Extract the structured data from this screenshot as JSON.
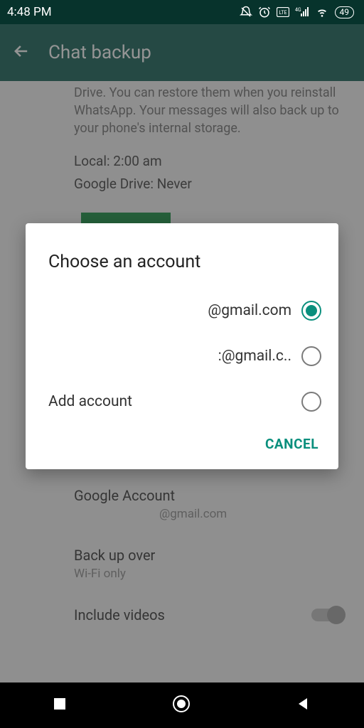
{
  "statusbar": {
    "time": "4:48 PM",
    "battery": "49"
  },
  "toolbar": {
    "title": "Chat backup"
  },
  "main": {
    "description": "Drive. You can restore them when you reinstall WhatsApp. Your messages will also back up to your phone's internal storage.",
    "local_line": "Local: 2:00 am",
    "gdrive_line": "Google Drive: Never"
  },
  "settings": {
    "google_account": {
      "label": "Google Account",
      "value": "@gmail.com"
    },
    "backup_over": {
      "label": "Back up over",
      "value": "Wi-Fi only"
    },
    "include_videos": {
      "label": "Include videos",
      "enabled": false
    }
  },
  "dialog": {
    "title": "Choose an account",
    "options": [
      {
        "label": "@gmail.com",
        "selected": true
      },
      {
        "label": ":@gmail.c..",
        "selected": false
      },
      {
        "label": "Add account",
        "selected": false
      }
    ],
    "cancel": "CANCEL"
  },
  "colors": {
    "accent": "#0a8f7d",
    "toolbar": "#0a5a4e",
    "button": "#0a8a39"
  }
}
